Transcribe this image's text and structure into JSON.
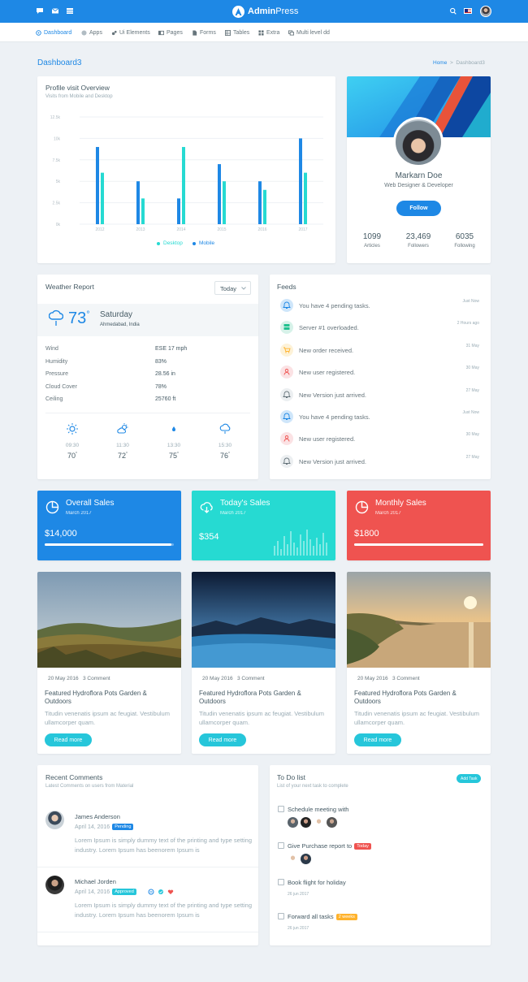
{
  "topbar": {
    "brand_bold": "Admin",
    "brand_light": "Press",
    "icons": [
      "message-icon",
      "mail-icon",
      "grid-icon",
      "search-icon",
      "flag-us-icon"
    ]
  },
  "nav": [
    {
      "label": "Dashboard",
      "icon": "dashboard-icon"
    },
    {
      "label": "Apps",
      "icon": "apps-icon"
    },
    {
      "label": "Ui Elements",
      "icon": "ui-elements-icon"
    },
    {
      "label": "Pages",
      "icon": "pages-icon"
    },
    {
      "label": "Forms",
      "icon": "forms-icon"
    },
    {
      "label": "Tables",
      "icon": "tables-icon"
    },
    {
      "label": "Extra",
      "icon": "extra-icon"
    },
    {
      "label": "Multi level dd",
      "icon": "multilevel-icon"
    }
  ],
  "page": {
    "title": "Dashboard3",
    "breadcrumb_home": "Home",
    "breadcrumb_sep": ">",
    "breadcrumb_current": "Dashboard3"
  },
  "overview": {
    "title": "Profile visit Overview",
    "subtitle": "Visits from Mobile and Desktop"
  },
  "chart_data": {
    "type": "bar",
    "title": "Profile visit Overview",
    "categories": [
      "2012",
      "2013",
      "2014",
      "2015",
      "2016",
      "2017"
    ],
    "y_ticks": [
      "0k",
      "2.5k",
      "5k",
      "7.5k",
      "10k",
      "12.5k"
    ],
    "ylim": [
      0,
      12500
    ],
    "grid": true,
    "legend_position": "bottom-center",
    "series": [
      {
        "name": "Desktop",
        "color": "#26dad2",
        "values": [
          6000,
          3000,
          9000,
          5000,
          4000,
          6000
        ]
      },
      {
        "name": "Mobile",
        "color": "#1e88e5",
        "values": [
          9000,
          5000,
          3000,
          7000,
          5000,
          10000
        ]
      }
    ]
  },
  "profile": {
    "name": "Markarn Doe",
    "role": "Web Designer & Developer",
    "follow_label": "Follow",
    "stats": [
      {
        "value": "1099",
        "label": "Articles"
      },
      {
        "value": "23,469",
        "label": "Followers"
      },
      {
        "value": "6035",
        "label": "Following"
      }
    ]
  },
  "weather": {
    "title": "Weather Report",
    "select_value": "Today",
    "temp": "73",
    "degree": "°",
    "day": "Saturday",
    "location": "Ahmedabad, India",
    "details": [
      {
        "label": "Wind",
        "value": "ESE 17 mph"
      },
      {
        "label": "Humidity",
        "value": "83%"
      },
      {
        "label": "Pressure",
        "value": "28.56 in"
      },
      {
        "label": "Cloud Cover",
        "value": "78%"
      },
      {
        "label": "Ceiling",
        "value": "25760 ft"
      }
    ],
    "forecast": [
      {
        "time": "09:30",
        "temp": "70",
        "icon": "sun-icon"
      },
      {
        "time": "11:30",
        "temp": "72",
        "icon": "sun-cloud-icon"
      },
      {
        "time": "13:30",
        "temp": "75",
        "icon": "rain-icon"
      },
      {
        "time": "15:30",
        "temp": "76",
        "icon": "cloud-icon"
      }
    ]
  },
  "feeds": {
    "title": "Feeds",
    "items": [
      {
        "text": "You have 4 pending tasks.",
        "time": "Just Now",
        "icon": "bell-icon",
        "bg": "#cfe6fa",
        "fg": "#1e88e5"
      },
      {
        "text": "Server #1 overloaded.",
        "time": "2 Hours ago",
        "icon": "server-icon",
        "bg": "#d7f2e9",
        "fg": "#21c18f"
      },
      {
        "text": "New order received.",
        "time": "31 May",
        "icon": "cart-icon",
        "bg": "#fdf2d8",
        "fg": "#ffb22b"
      },
      {
        "text": "New user registered.",
        "time": "30 May",
        "icon": "user-icon",
        "bg": "#fbe2e4",
        "fg": "#ef5350"
      },
      {
        "text": "New Version just arrived.",
        "time": "27 May",
        "icon": "bell-icon",
        "bg": "#eceff1",
        "fg": "#67757c"
      },
      {
        "text": "You have 4 pending tasks.",
        "time": "Just Now",
        "icon": "bell-icon",
        "bg": "#cfe6fa",
        "fg": "#1e88e5"
      },
      {
        "text": "New user registered.",
        "time": "30 May",
        "icon": "user-icon",
        "bg": "#fbe2e4",
        "fg": "#ef5350"
      },
      {
        "text": "New Version just arrived.",
        "time": "27 May",
        "icon": "bell-icon",
        "bg": "#eceff1",
        "fg": "#67757c"
      }
    ]
  },
  "sales": [
    {
      "title": "Overall Sales",
      "sub": "March 2017",
      "value": "$14,000",
      "color": "#1e88e5",
      "progress": 0.98
    },
    {
      "title": "Today's Sales",
      "sub": "March 2017",
      "value": "$354",
      "color": "#26dad2"
    },
    {
      "title": "Monthly Sales",
      "sub": "March 2017",
      "value": "$1800",
      "color": "#ef5350",
      "progress": 1.0
    }
  ],
  "blog": [
    {
      "date": "20 May 2016",
      "comments": "3 Comment",
      "title": "Featured Hydroflora Pots Garden & Outdoors",
      "text": "Titudin venenatis ipsum ac feugiat. Vestibulum ullamcorper quam.",
      "button": "Read more"
    },
    {
      "date": "20 May 2016",
      "comments": "3 Comment",
      "title": "Featured Hydroflora Pots Garden & Outdoors",
      "text": "Titudin venenatis ipsum ac feugiat. Vestibulum ullamcorper quam.",
      "button": "Read more"
    },
    {
      "date": "20 May 2016",
      "comments": "3 Comment",
      "title": "Featured Hydroflora Pots Garden & Outdoors",
      "text": "Titudin venenatis ipsum ac feugiat. Vestibulum ullamcorper quam.",
      "button": "Read more"
    }
  ],
  "comments": {
    "title": "Recent Comments",
    "subtitle": "Latest Comments on users from Material",
    "items": [
      {
        "name": "James Anderson",
        "date": "April 14, 2016",
        "badge": "Pending",
        "badge_color": "#1e88e5",
        "text": "Lorem Ipsum is simply dummy text of the printing and type setting industry. Lorem Ipsum has beenorem Ipsum is"
      },
      {
        "name": "Michael Jorden",
        "date": "April 14, 2016",
        "badge": "Approved",
        "badge_color": "#26c6da",
        "text": "Lorem Ipsum is simply dummy text of the printing and type setting industry. Lorem Ipsum has beenorem Ipsum is"
      }
    ]
  },
  "todo": {
    "title": "To Do list",
    "subtitle": "List of your next task to complete",
    "add_label": "Add Task",
    "items": [
      {
        "text": "Schedule meeting with",
        "badge": "",
        "date": ""
      },
      {
        "text": "Give Purchase report to",
        "badge": "Today",
        "badge_color": "#ef5350",
        "date": ""
      },
      {
        "text": "Book flight for holiday",
        "badge": "",
        "date": "26 jun 2017"
      },
      {
        "text": "Forward all tasks",
        "badge": "2 weeks",
        "badge_color": "#ffb22b",
        "date": "26 jun 2017"
      }
    ]
  }
}
